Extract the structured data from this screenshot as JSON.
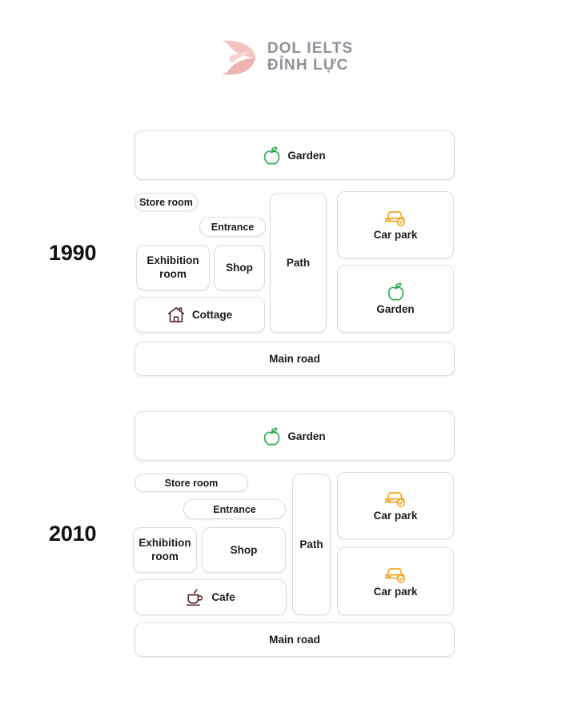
{
  "logo": {
    "name": "dol-ielts-logo",
    "line1": "DOL IELTS",
    "line2": "ĐỈNH LỰC",
    "text_color": "#8e9299",
    "mark_color_light": "#f2c3c0",
    "mark_color_dark": "#e8a7a4"
  },
  "colors": {
    "box_border": "#dcdcdc",
    "box_background": "#ffffff",
    "text": "#1b1b1b",
    "garden_icon": "#2aa84a",
    "carpark_icon": "#f5a623",
    "cottage_icon": "#5c3231",
    "cafe_icon": "#5c3231",
    "page_background": "#ffffff"
  },
  "diagrams": [
    {
      "year": "1990",
      "boxes": [
        {
          "name": "garden-top",
          "label": "Garden",
          "icon": "apple-icon",
          "icon_color": "#2aa84a",
          "layout": "inline"
        },
        {
          "name": "store-room",
          "label": "Store room",
          "icon": null,
          "layout": "plain"
        },
        {
          "name": "entrance",
          "label": "Entrance",
          "icon": null,
          "layout": "plain"
        },
        {
          "name": "exhibition-room",
          "label": "Exhibition room",
          "icon": null,
          "layout": "multiline"
        },
        {
          "name": "shop",
          "label": "Shop",
          "icon": null,
          "layout": "plain"
        },
        {
          "name": "cottage",
          "label": "Cottage",
          "icon": "house-icon",
          "icon_color": "#5c3231",
          "layout": "inline"
        },
        {
          "name": "path",
          "label": "Path",
          "icon": null,
          "layout": "plain"
        },
        {
          "name": "car-park",
          "label": "Car park",
          "icon": "car-icon",
          "icon_color": "#f5a623",
          "layout": "stacked"
        },
        {
          "name": "garden-right",
          "label": "Garden",
          "icon": "apple-icon",
          "icon_color": "#2aa84a",
          "layout": "stacked"
        },
        {
          "name": "main-road",
          "label": "Main road",
          "icon": null,
          "layout": "plain"
        }
      ]
    },
    {
      "year": "2010",
      "boxes": [
        {
          "name": "garden-top",
          "label": "Garden",
          "icon": "apple-icon",
          "icon_color": "#2aa84a",
          "layout": "inline"
        },
        {
          "name": "store-room",
          "label": "Store room",
          "icon": null,
          "layout": "plain"
        },
        {
          "name": "entrance",
          "label": "Entrance",
          "icon": null,
          "layout": "plain"
        },
        {
          "name": "exhibition-room",
          "label": "Exhibition room",
          "icon": null,
          "layout": "multiline"
        },
        {
          "name": "shop",
          "label": "Shop",
          "icon": null,
          "layout": "plain"
        },
        {
          "name": "cafe",
          "label": "Cafe",
          "icon": "coffee-icon",
          "icon_color": "#5c3231",
          "layout": "inline"
        },
        {
          "name": "path",
          "label": "Path",
          "icon": null,
          "layout": "plain"
        },
        {
          "name": "car-park-top",
          "label": "Car park",
          "icon": "car-icon",
          "icon_color": "#f5a623",
          "layout": "stacked"
        },
        {
          "name": "car-park-bottom",
          "label": "Car park",
          "icon": "car-icon",
          "icon_color": "#f5a623",
          "layout": "stacked"
        },
        {
          "name": "main-road",
          "label": "Main road",
          "icon": null,
          "layout": "plain"
        }
      ]
    }
  ]
}
